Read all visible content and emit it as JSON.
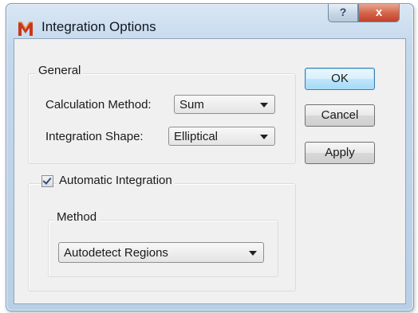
{
  "window": {
    "title": "Integration Options",
    "help_label": "?",
    "close_label": "x"
  },
  "general": {
    "label": "General",
    "calc_method_label": "Calculation Method:",
    "calc_method_value": "Sum",
    "shape_label": "Integration Shape:",
    "shape_value": "Elliptical"
  },
  "automatic": {
    "label": "Automatic Integration",
    "checked": true,
    "method_label": "Method",
    "method_value": "Autodetect Regions"
  },
  "buttons": {
    "ok": "OK",
    "cancel": "Cancel",
    "apply": "Apply"
  },
  "colors": {
    "window_frame": "#c4d8ec",
    "close_button": "#d5674b",
    "ok_highlight": "#bee6fd"
  }
}
